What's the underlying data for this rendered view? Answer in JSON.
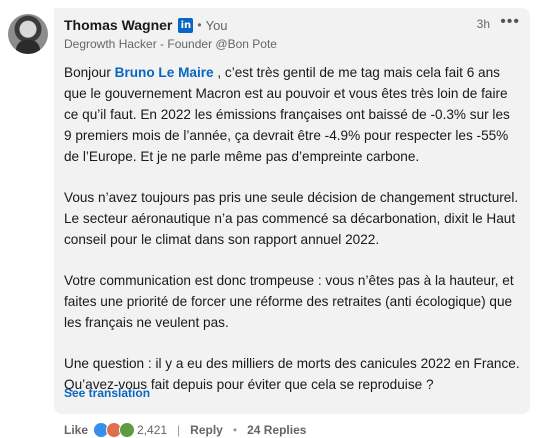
{
  "author": {
    "name": "Thomas Wagner",
    "badge": "in",
    "relation": "You",
    "headline": "Degrowth Hacker - Founder @Bon Pote",
    "time": "3h",
    "more": "•••"
  },
  "comment": {
    "p1_before": "Bonjour ",
    "mention": "Bruno Le Maire",
    "p1_after": " , c’est très gentil de me tag mais cela fait 6 ans que le gouvernement Macron est au pouvoir et vous êtes très loin de faire ce qu’il faut. En 2022 les émissions françaises ont baissé de -0.3% sur les 9 premiers mois de l’année, ça devrait être -4.9% pour respecter les -55% de l’Europe. Et je ne parle même pas d’empreinte carbone.",
    "p2": "Vous n’avez toujours pas pris une seule décision de changement structurel. Le secteur aéronautique n’a pas commencé sa décarbonation, dixit le Haut conseil pour le climat dans son rapport annuel 2022.",
    "p3": "Votre communication est donc trompeuse : vous n’êtes pas à la hauteur, et faites une priorité de forcer une réforme des retraites (anti écologique) que les français ne veulent pas.",
    "p4": "Une question : il y a eu des milliers de morts des canicules 2022 en France. Qu’avez-vous fait depuis pour éviter que cela se reproduise ?"
  },
  "see_translation": "See translation",
  "footer": {
    "like": "Like",
    "reaction_count": "2,421",
    "reply": "Reply",
    "replies": "24 Replies"
  },
  "colors": {
    "link": "#0a66c2",
    "bubble": "#f2f2f2"
  }
}
